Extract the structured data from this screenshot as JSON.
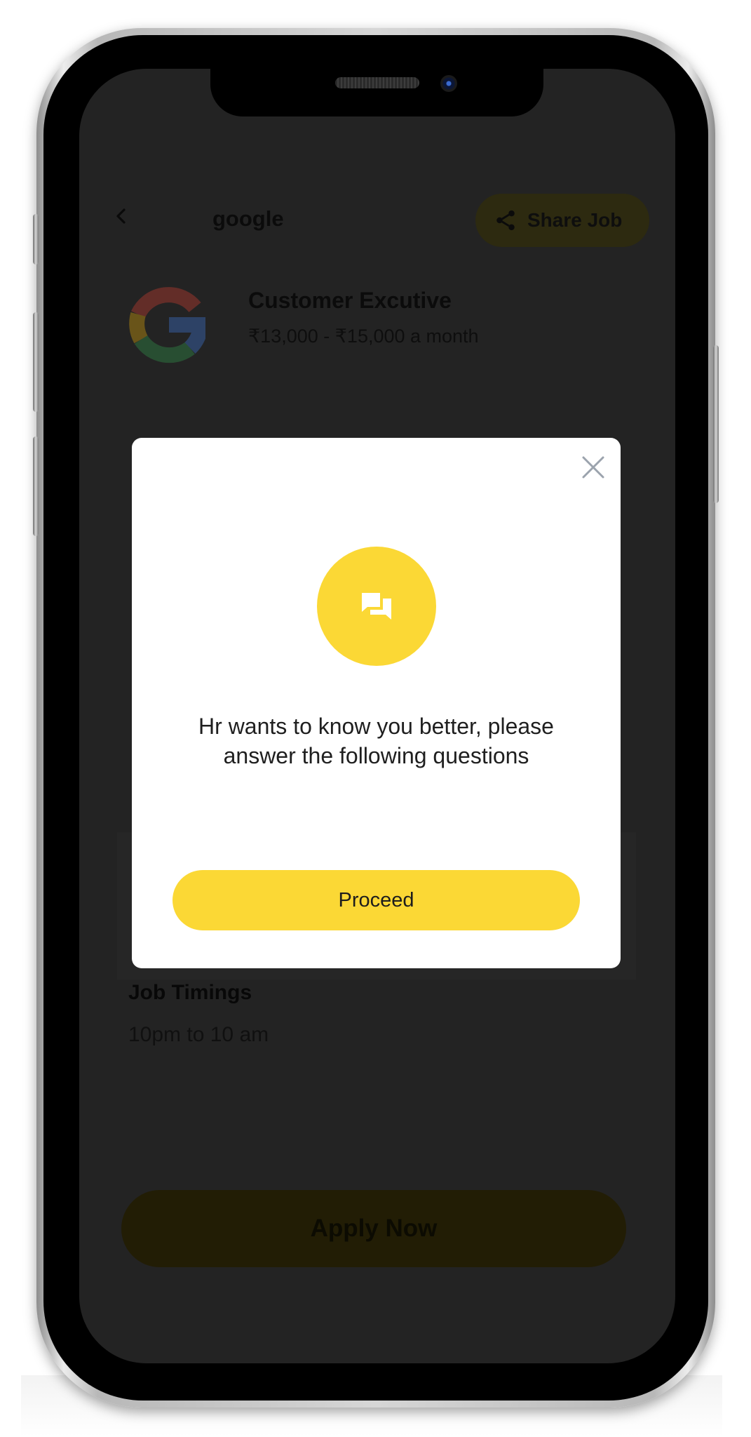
{
  "header": {
    "title": "google",
    "share_label": "Share Job"
  },
  "job": {
    "title": "Customer Excutive",
    "salary": "₹13,000 - ₹15,000 a month",
    "timings_label": "Job Timings",
    "timings_value": "10pm to 10 am"
  },
  "footer": {
    "apply_label": "Apply Now"
  },
  "modal": {
    "message_line1": "Hr wants to know you better, please",
    "message_line2": "answer the following questions",
    "proceed_label": "Proceed"
  },
  "colors": {
    "accent": "#fbd835",
    "overlay": "#232323"
  },
  "icons": [
    "back-arrow-icon",
    "share-icon",
    "google-logo",
    "close-icon",
    "chat-icon",
    "camera-icon"
  ]
}
